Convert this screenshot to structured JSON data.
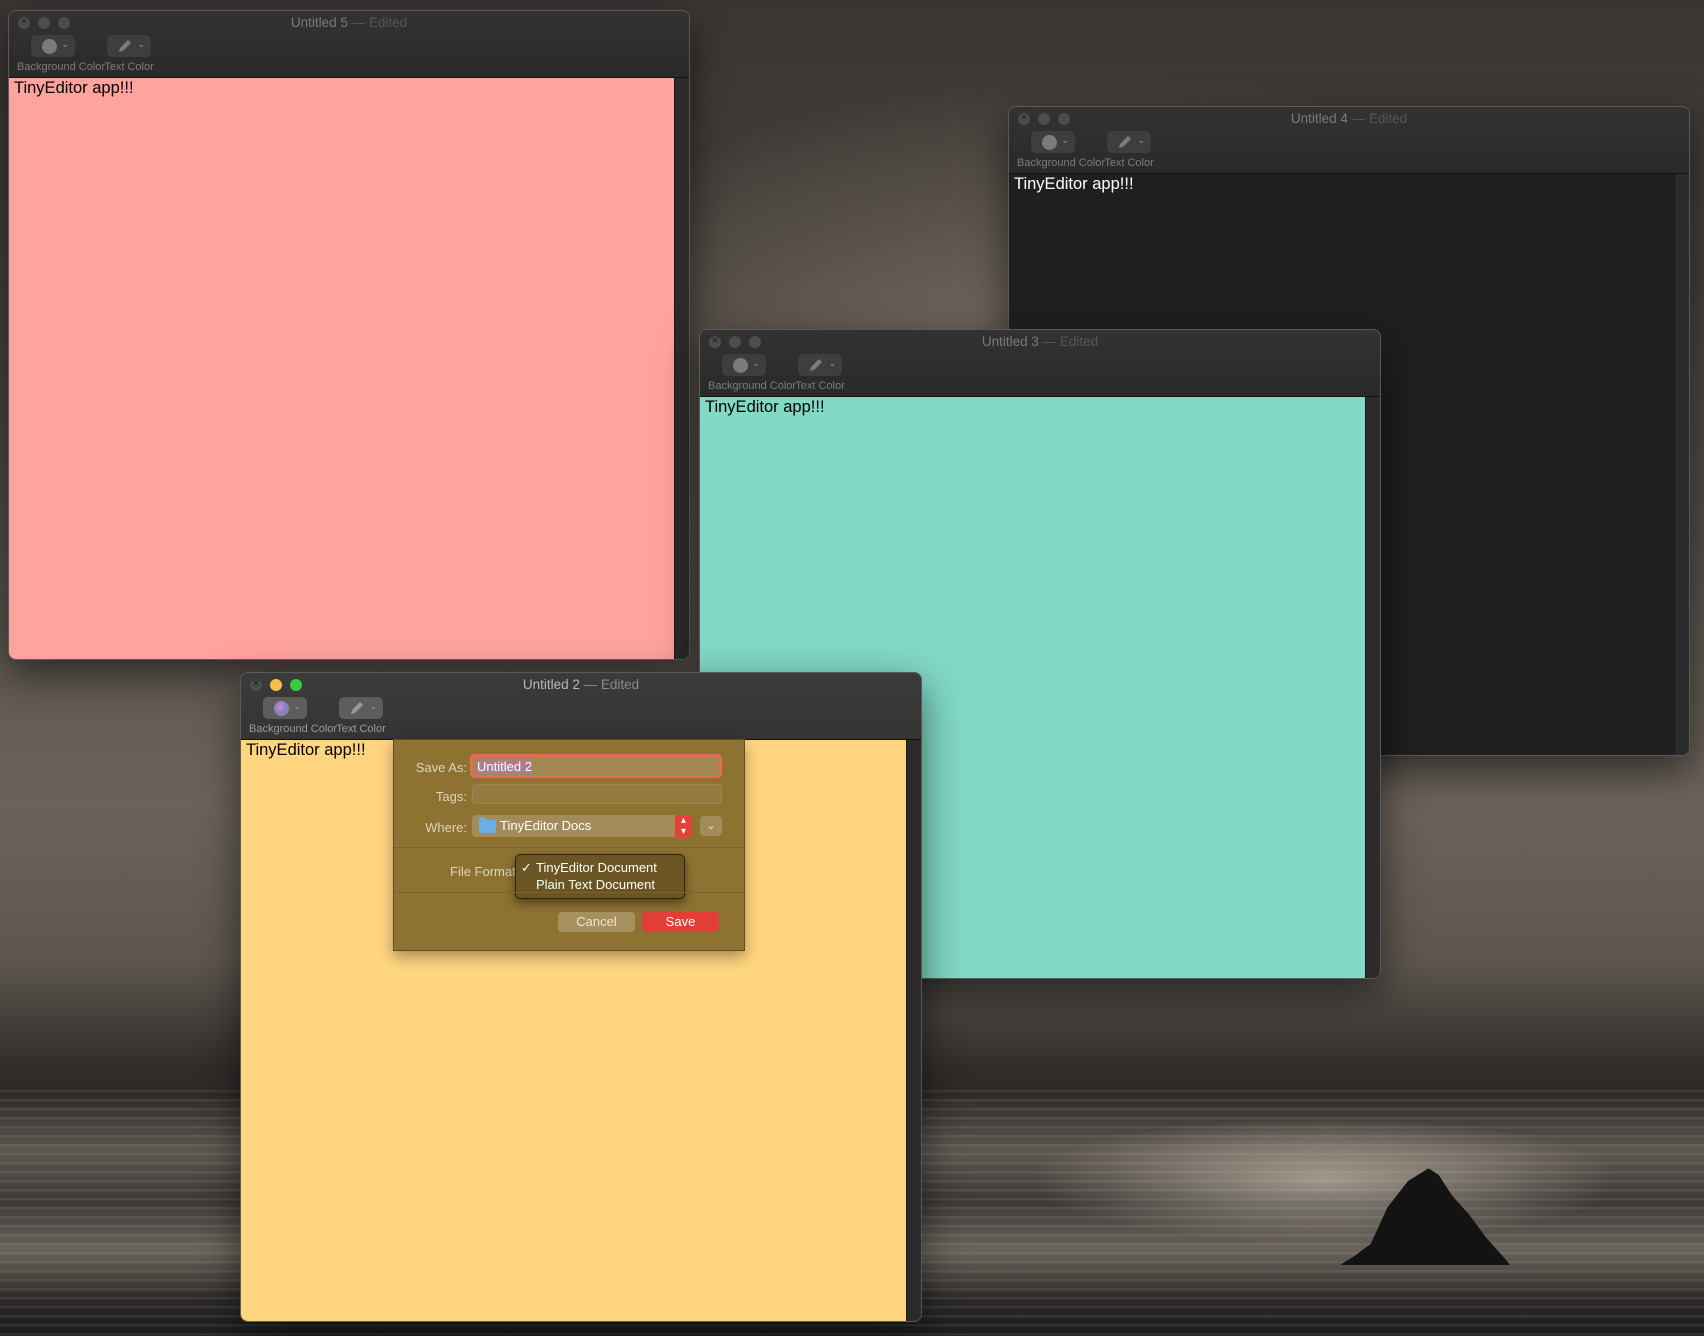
{
  "windows": {
    "w5": {
      "title": "Untitled 5",
      "edited": "— Edited",
      "text": "TinyEditor app!!!"
    },
    "w4": {
      "title": "Untitled 4",
      "edited": "— Edited",
      "text": "TinyEditor app!!!"
    },
    "w3": {
      "title": "Untitled 3",
      "edited": "— Edited",
      "text": "TinyEditor app!!!"
    },
    "w2": {
      "title": "Untitled 2",
      "edited": "— Edited",
      "text": "TinyEditor app!!!"
    }
  },
  "toolbar": {
    "background_color_label": "Background Color",
    "text_color_label": "Text Color"
  },
  "colors": {
    "w5_bg": "#ffa39e",
    "w4_bg": "#1f1f1f",
    "w3_bg": "#82d9c5",
    "w2_bg": "#ffd580",
    "accent": "#e3423a"
  },
  "save_sheet": {
    "save_as_label": "Save As:",
    "save_as_value": "Untitled 2",
    "tags_label": "Tags:",
    "where_label": "Where:",
    "where_value": "TinyEditor Docs",
    "file_format_label": "File Format:",
    "format_options": [
      "TinyEditor Document",
      "Plain Text Document"
    ],
    "selected_format": "TinyEditor Document",
    "check_mark": "✓",
    "cancel_label": "Cancel",
    "save_label": "Save"
  },
  "icons": {
    "color_swatch": "color-wheel-icon",
    "pencil": "pencil-icon",
    "chevron": "chevron-down-icon",
    "folder": "folder-icon",
    "stepper": "up-down-stepper-icon"
  }
}
